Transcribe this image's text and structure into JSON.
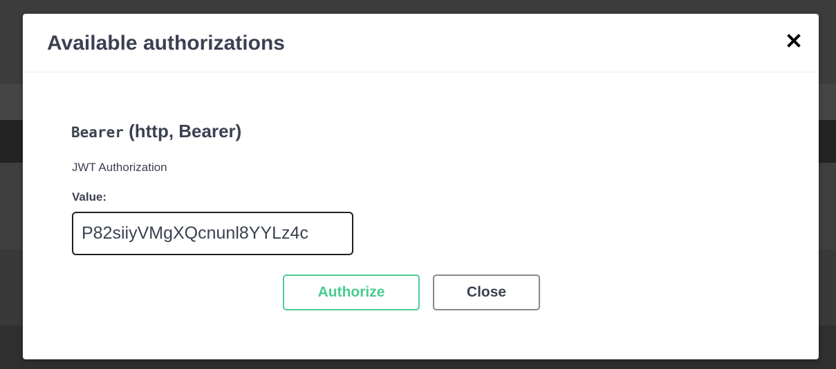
{
  "modal": {
    "title": "Available authorizations",
    "close_icon": "close-icon"
  },
  "scheme": {
    "name": "Bearer",
    "type_label": "(http, Bearer)",
    "description": "JWT Authorization",
    "value_label": "Value:",
    "value": "P82siiyVMgXQcnunl8YYLz4c"
  },
  "actions": {
    "authorize_label": "Authorize",
    "close_label": "Close"
  },
  "colors": {
    "accent_green": "#49cc90",
    "text_dark": "#3b4151",
    "close_border": "#888888"
  }
}
